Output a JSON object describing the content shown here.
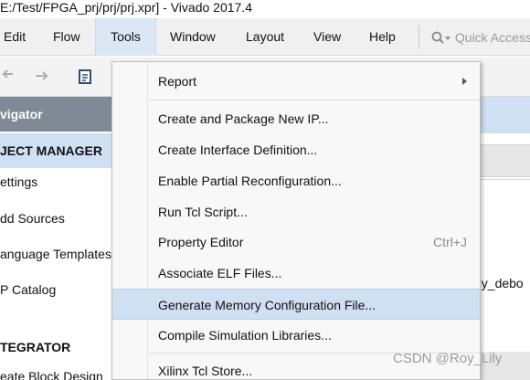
{
  "window": {
    "title": "E:/Test/FPGA_prj/prj/prj.xpr] - Vivado 2017.4"
  },
  "menubar": {
    "items": [
      "Edit",
      "Flow",
      "Tools",
      "Window",
      "Layout",
      "View",
      "Help"
    ],
    "active": "Tools",
    "quick_access_placeholder": "Quick Access"
  },
  "navigator": {
    "header": "vigator",
    "project_manager": "JECT MANAGER",
    "items": [
      "ettings",
      "dd Sources",
      "anguage Templates",
      "P Catalog"
    ],
    "ip_integrator": "TEGRATOR",
    "ip_items": [
      "eate Block Design"
    ]
  },
  "right_panel": {
    "visible_text": "ey_debo"
  },
  "tools_menu": {
    "items": [
      {
        "label": "Report",
        "submenu": true
      },
      {
        "label": "Create and Package New IP..."
      },
      {
        "label": "Create Interface Definition..."
      },
      {
        "label": "Enable Partial Reconfiguration..."
      },
      {
        "label": "Run Tcl Script..."
      },
      {
        "label": "Property Editor",
        "shortcut": "Ctrl+J"
      },
      {
        "label": "Associate ELF Files..."
      },
      {
        "label": "Generate Memory Configuration File...",
        "highlighted": true
      },
      {
        "label": "Compile Simulation Libraries..."
      },
      {
        "label": "Xilinx Tcl Store..."
      }
    ]
  },
  "watermark": "CSDN @Roy_Lily",
  "colors": {
    "highlight": "#cfe0f3",
    "navigator_header": "#7f8a96",
    "menubar": "#f0f0f0"
  }
}
